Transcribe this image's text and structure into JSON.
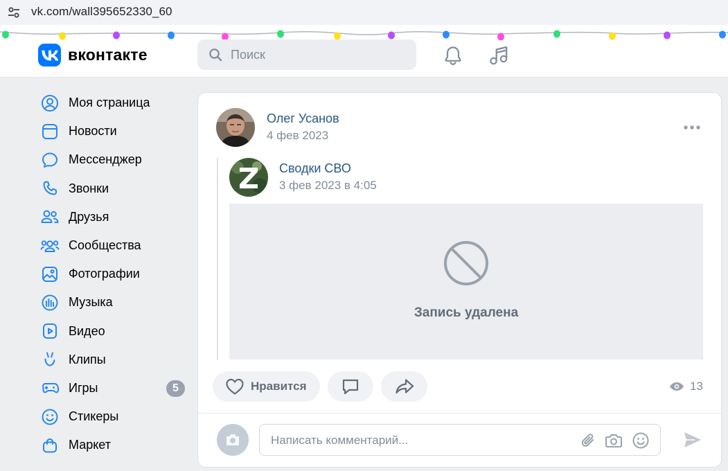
{
  "browser": {
    "url": "vk.com/wall395652330_60"
  },
  "header": {
    "logo_text": "вконтакте",
    "search_placeholder": "Поиск"
  },
  "sidebar": {
    "items": [
      {
        "label": "Моя страница",
        "icon": "user-circle-icon"
      },
      {
        "label": "Новости",
        "icon": "newsfeed-icon"
      },
      {
        "label": "Мессенджер",
        "icon": "message-icon"
      },
      {
        "label": "Звонки",
        "icon": "phone-icon"
      },
      {
        "label": "Друзья",
        "icon": "friends-icon"
      },
      {
        "label": "Сообщества",
        "icon": "communities-icon"
      },
      {
        "label": "Фотографии",
        "icon": "photo-icon"
      },
      {
        "label": "Музыка",
        "icon": "music-icon"
      },
      {
        "label": "Видео",
        "icon": "video-icon"
      },
      {
        "label": "Клипы",
        "icon": "clips-icon"
      },
      {
        "label": "Игры",
        "icon": "gamepad-icon",
        "badge": "5"
      },
      {
        "label": "Стикеры",
        "icon": "smile-icon"
      },
      {
        "label": "Маркет",
        "icon": "market-bag-icon"
      }
    ]
  },
  "post": {
    "author": "Олег Усанов",
    "date": "4 фев 2023",
    "repost": {
      "author": "Сводки СВО",
      "date": "3 фев 2023 в 4:05",
      "deleted_text": "Запись удалена"
    },
    "like_label": "Нравится",
    "views": "13"
  },
  "comment": {
    "placeholder": "Написать комментарий..."
  },
  "colors": {
    "accent": "#0077ff",
    "link": "#2a5885",
    "muted": "#818c99",
    "icon": "#2688eb"
  }
}
